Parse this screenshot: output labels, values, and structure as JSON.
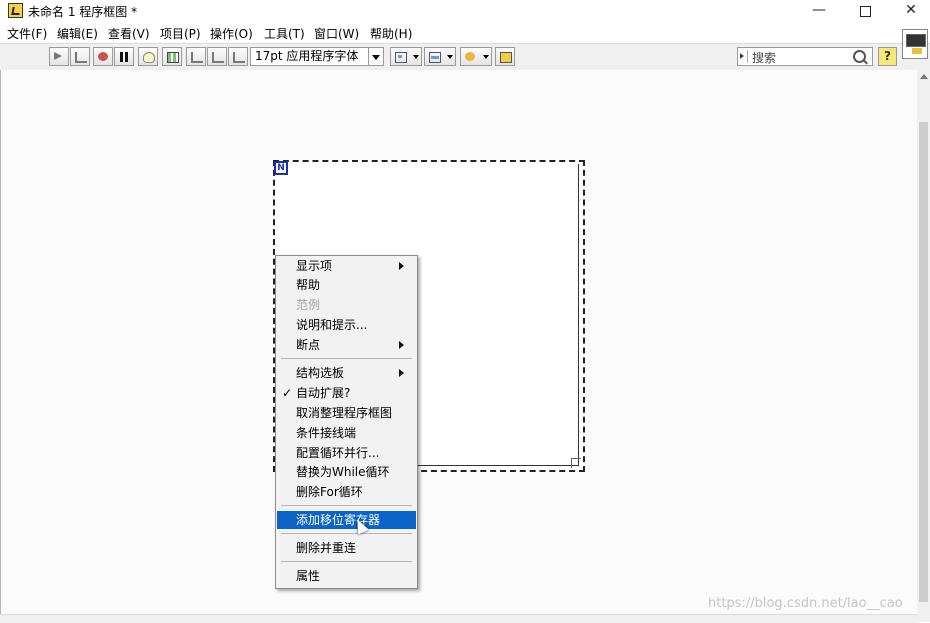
{
  "window": {
    "title": "未命名 1 程序框图 *",
    "controls": {
      "minimize": "—",
      "close": "✕"
    }
  },
  "menubar": {
    "items": [
      {
        "label": "文件(F)"
      },
      {
        "label": "编辑(E)"
      },
      {
        "label": "查看(V)"
      },
      {
        "label": "项目(P)"
      },
      {
        "label": "操作(O)"
      },
      {
        "label": "工具(T)"
      },
      {
        "label": "窗口(W)"
      },
      {
        "label": "帮助(H)"
      }
    ]
  },
  "toolbar": {
    "font": "17pt 应用程序字体",
    "search_placeholder": "搜索",
    "help": "?"
  },
  "diagram": {
    "for_loop_count_terminal": "N"
  },
  "context_menu": {
    "items": [
      {
        "label": "显示项",
        "submenu": true
      },
      {
        "label": "帮助"
      },
      {
        "label": "范例",
        "disabled": true
      },
      {
        "label": "说明和提示..."
      },
      {
        "label": "断点",
        "submenu": true
      },
      {
        "label": "结构选板",
        "submenu": true
      },
      {
        "label": "自动扩展?",
        "checked": true,
        "check_mark": "✓"
      },
      {
        "label": "取消整理程序框图"
      },
      {
        "label": "条件接线端"
      },
      {
        "label": "配置循环并行..."
      },
      {
        "label": "替换为While循环"
      },
      {
        "label": "删除For循环"
      },
      {
        "label": "添加移位寄存器",
        "highlighted": true
      },
      {
        "label": "删除并重连"
      },
      {
        "label": "属性"
      }
    ],
    "highlight_color": "#0a64c8"
  },
  "watermark": "https://blog.csdn.net/lao__cao"
}
